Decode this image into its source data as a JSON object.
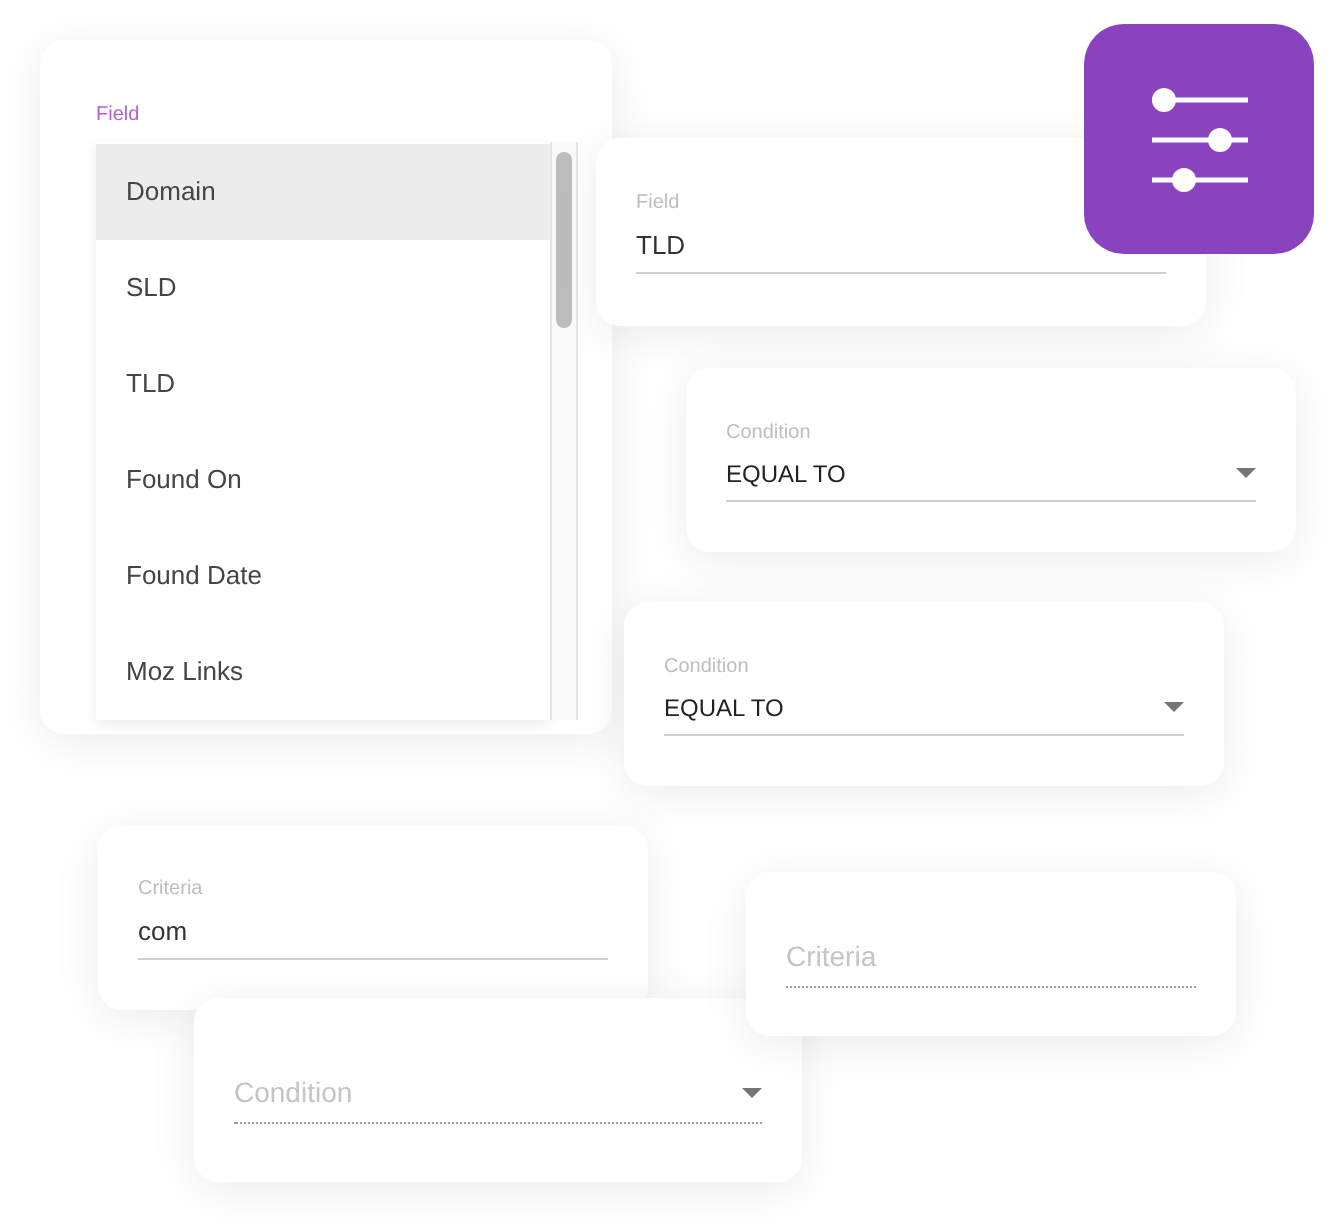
{
  "field_list": {
    "label": "Field",
    "items": [
      {
        "label": "Domain",
        "selected": true
      },
      {
        "label": "SLD",
        "selected": false
      },
      {
        "label": "TLD",
        "selected": false
      },
      {
        "label": "Found On",
        "selected": false
      },
      {
        "label": "Found Date",
        "selected": false
      },
      {
        "label": "Moz Links",
        "selected": false
      }
    ]
  },
  "cards": [
    {
      "kind": "text",
      "label": "Field",
      "value": "TLD"
    },
    {
      "kind": "select",
      "label": "Condition",
      "value": "EQUAL TO"
    },
    {
      "kind": "select",
      "label": "Condition",
      "value": "EQUAL TO"
    },
    {
      "kind": "text",
      "label": "Criteria",
      "value": "com"
    },
    {
      "kind": "text",
      "placeholder": "Criteria"
    },
    {
      "kind": "select",
      "placeholder": "Condition"
    }
  ]
}
